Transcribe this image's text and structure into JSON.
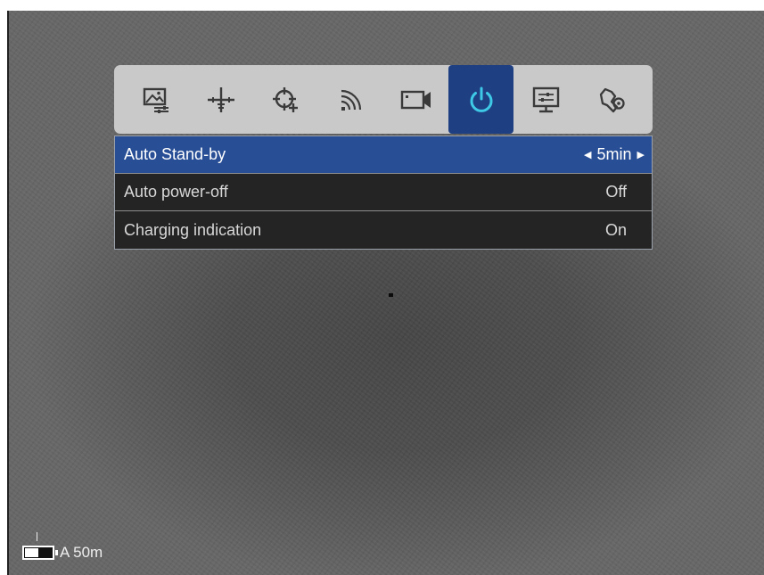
{
  "menu": {
    "tabs": [
      {
        "icon": "image-settings-icon",
        "active": false
      },
      {
        "icon": "reticle-icon",
        "active": false
      },
      {
        "icon": "zeroing-icon",
        "active": false
      },
      {
        "icon": "wifi-icon",
        "active": false
      },
      {
        "icon": "video-icon",
        "active": false
      },
      {
        "icon": "power-icon",
        "active": true
      },
      {
        "icon": "display-settings-icon",
        "active": false
      },
      {
        "icon": "general-settings-icon",
        "active": false
      }
    ],
    "rows": [
      {
        "label": "Auto Stand-by",
        "value": "5min",
        "selected": true
      },
      {
        "label": "Auto power-off",
        "value": "Off",
        "selected": false
      },
      {
        "label": "Charging indication",
        "value": "On",
        "selected": false
      }
    ]
  },
  "status": {
    "range_text": "A 50m",
    "battery_level": 0.5
  },
  "colors": {
    "accent": "#284e96",
    "active_tab": "#1f3f83",
    "icon_active": "#3ec9e6",
    "icon_inactive": "#3a3a3a"
  }
}
